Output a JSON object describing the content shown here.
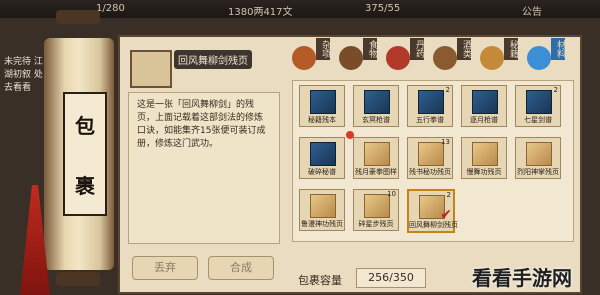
{
  "topbar": {
    "left": "1/280",
    "middle": "1380两417文",
    "right": "375/55",
    "notice": "公告"
  },
  "sidebar": {
    "text": "未完待 江湖初叙 处去看看"
  },
  "scroll": {
    "title_char1": "包",
    "title_char2": "裹"
  },
  "item": {
    "name": "回风舞柳剑残页",
    "description": "这是一张「回风舞柳剑」的残页，上面记载着这部剑法的修炼口诀，如能集齐15张便可装订成册，修炼这门武功。"
  },
  "tabs": [
    {
      "label": "杂项",
      "icon": "misc-icon",
      "color": "#b45a26"
    },
    {
      "label": "食物",
      "icon": "food-icon",
      "color": "#7a4d2a"
    },
    {
      "label": "丹药",
      "icon": "pill-icon",
      "color": "#b13a2a"
    },
    {
      "label": "酒类",
      "icon": "wine-icon",
      "color": "#8a5a30"
    },
    {
      "label": "秘籍",
      "icon": "scroll-icon",
      "color": "#c48a3a"
    },
    {
      "label": "材料",
      "icon": "crystal-icon",
      "color": "#3a8fd6"
    }
  ],
  "slots": [
    {
      "label": "秘籍残本",
      "count": "",
      "kind": "book"
    },
    {
      "label": "玄冥枪谱",
      "count": "",
      "kind": "book"
    },
    {
      "label": "五行拳谱",
      "count": "2",
      "kind": "book"
    },
    {
      "label": "逐月枪谱",
      "count": "",
      "kind": "book"
    },
    {
      "label": "七星剑谱",
      "count": "2",
      "kind": "book"
    },
    {
      "label": "破碎秘谱",
      "count": "",
      "kind": "book"
    },
    {
      "label": "残月豪拳图样",
      "count": "",
      "kind": "page"
    },
    {
      "label": "残书秘功残页",
      "count": "13",
      "kind": "page"
    },
    {
      "label": "慢舞功残页",
      "count": "",
      "kind": "page"
    },
    {
      "label": "烈阳神掌残页",
      "count": "",
      "kind": "page"
    },
    {
      "label": "鲁漫神功残页",
      "count": "",
      "kind": "page"
    },
    {
      "label": "碎星步残页",
      "count": "10",
      "kind": "page"
    },
    {
      "label": "回风舞柳剑残页",
      "count": "2",
      "kind": "page"
    }
  ],
  "buttons": {
    "discard": "丢弃",
    "combine": "合成"
  },
  "capacity": {
    "label": "包裹容量",
    "value": "256/350"
  },
  "watermark": "看看手游网"
}
